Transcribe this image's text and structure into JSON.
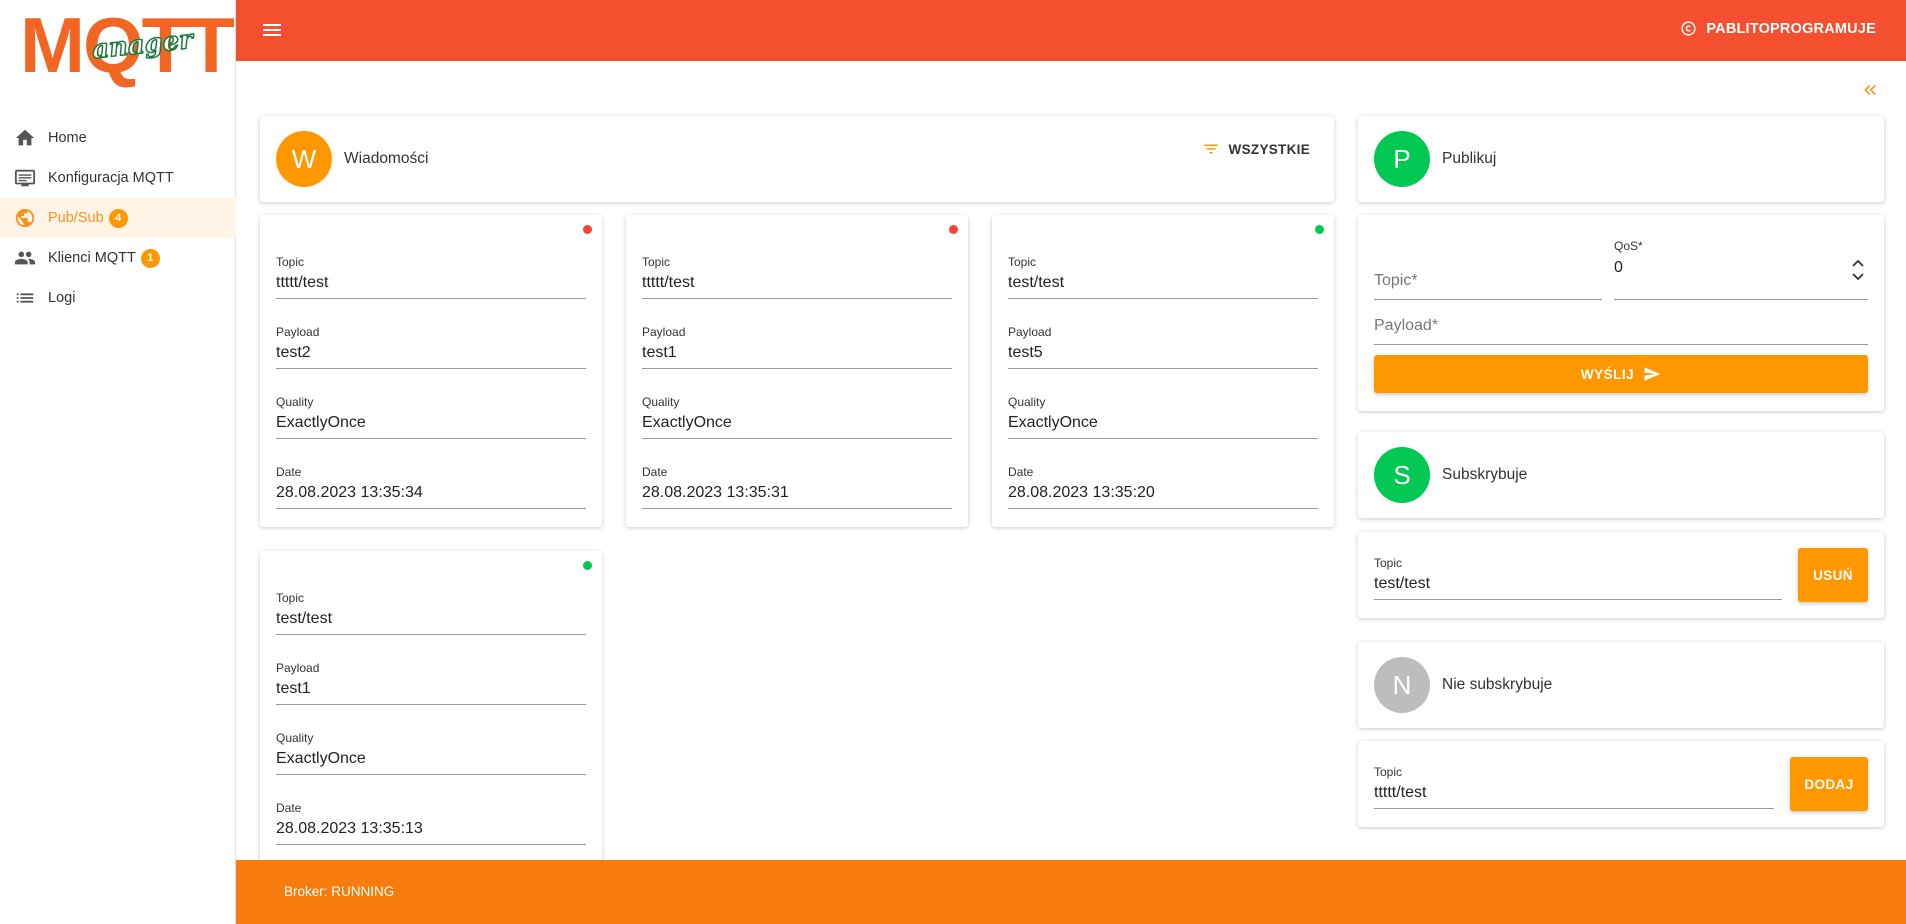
{
  "logo": {
    "main": "MQTT",
    "sub": "anager"
  },
  "nav": {
    "items": [
      {
        "label": "Home",
        "icon": "home-icon"
      },
      {
        "label": "Konfiguracja MQTT",
        "icon": "settings-display-icon"
      },
      {
        "label": "Pub/Sub",
        "icon": "globe-icon",
        "badge": "4"
      },
      {
        "label": "Klienci MQTT",
        "icon": "people-icon",
        "badge": "1"
      },
      {
        "label": "Logi",
        "icon": "list-icon"
      }
    ]
  },
  "topbar": {
    "account_label": "PABLITOPROGRAMUJE"
  },
  "messages": {
    "avatar": "W",
    "title": "Wiadomości",
    "filter_label": "WSZYSTKIE",
    "labels": {
      "topic": "Topic",
      "payload": "Payload",
      "quality": "Quality",
      "date": "Date"
    },
    "items": [
      {
        "topic": "ttttt/test",
        "payload": "test2",
        "quality": "ExactlyOnce",
        "date": "28.08.2023 13:35:34",
        "status_color": "#f44336"
      },
      {
        "topic": "ttttt/test",
        "payload": "test1",
        "quality": "ExactlyOnce",
        "date": "28.08.2023 13:35:31",
        "status_color": "#f44336"
      },
      {
        "topic": "test/test",
        "payload": "test5",
        "quality": "ExactlyOnce",
        "date": "28.08.2023 13:35:20",
        "status_color": "#00c853"
      },
      {
        "topic": "test/test",
        "payload": "test1",
        "quality": "ExactlyOnce",
        "date": "28.08.2023 13:35:13",
        "status_color": "#00c853"
      }
    ]
  },
  "publish": {
    "avatar": "P",
    "title": "Publikuj",
    "topic_placeholder": "Topic*",
    "qos_label": "QoS*",
    "qos_value": "0",
    "payload_placeholder": "Payload*",
    "send_label": "WYŚLIJ"
  },
  "subscribed": {
    "avatar": "S",
    "title": "Subskrybuje",
    "topic_label": "Topic",
    "topic_value": "test/test",
    "button_label": "USUŃ"
  },
  "unsubscribed": {
    "avatar": "N",
    "title": "Nie subskrybuje",
    "topic_label": "Topic",
    "topic_value": "ttttt/test",
    "button_label": "DODAJ"
  },
  "footer": {
    "status": "Broker: RUNNING"
  },
  "colors": {
    "topbar": "#f4502f",
    "accent": "#ff9800",
    "footer": "#f57c0d",
    "green": "#00c853",
    "red": "#f44336",
    "gray": "#bdbdbd"
  }
}
